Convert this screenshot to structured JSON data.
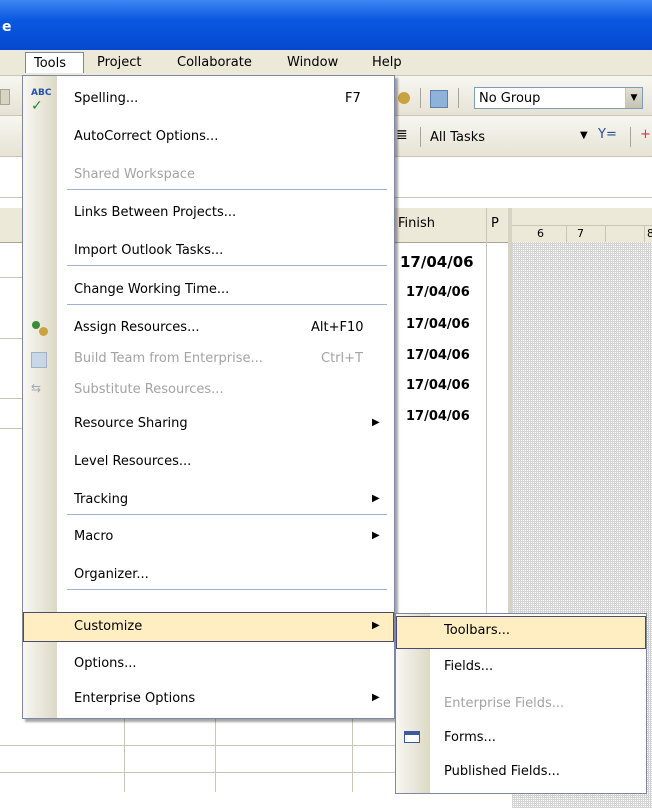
{
  "window_title": "e",
  "menubar": {
    "items": [
      "Tools",
      "Project",
      "Collaborate",
      "Window",
      "Help"
    ]
  },
  "toolbar": {
    "group_combo": "No Group",
    "filter_combo": "All Tasks"
  },
  "table": {
    "headers": {
      "finish": "Finish",
      "pred": "P"
    },
    "timescale_days": [
      "6",
      "7",
      "8"
    ],
    "finish_dates": [
      "17/04/06",
      "17/04/06",
      "17/04/06",
      "17/04/06",
      "17/04/06",
      "17/04/06"
    ]
  },
  "tools_menu": {
    "items": [
      {
        "label": "Spelling...",
        "shortcut": "F7"
      },
      {
        "label": "AutoCorrect Options..."
      },
      {
        "label": "Shared Workspace"
      },
      {
        "label": "Links Between Projects..."
      },
      {
        "label": "Import Outlook Tasks..."
      },
      {
        "label": "Change Working Time..."
      },
      {
        "label": "Assign Resources...",
        "shortcut": "Alt+F10"
      },
      {
        "label": "Build Team from Enterprise...",
        "shortcut": "Ctrl+T"
      },
      {
        "label": "Substitute Resources..."
      },
      {
        "label": "Resource Sharing"
      },
      {
        "label": "Level Resources..."
      },
      {
        "label": "Tracking"
      },
      {
        "label": "Macro"
      },
      {
        "label": "Organizer..."
      },
      {
        "label": "Customize"
      },
      {
        "label": "Options..."
      },
      {
        "label": "Enterprise Options"
      }
    ]
  },
  "customize_submenu": {
    "items": [
      {
        "label": "Toolbars..."
      },
      {
        "label": "Fields..."
      },
      {
        "label": "Enterprise Fields..."
      },
      {
        "label": "Forms..."
      },
      {
        "label": "Published Fields..."
      }
    ]
  },
  "colors": {
    "titlebar": "#0a58e0",
    "menu_highlight": "#ffeec2",
    "menu_border": "#7b8aa0"
  }
}
